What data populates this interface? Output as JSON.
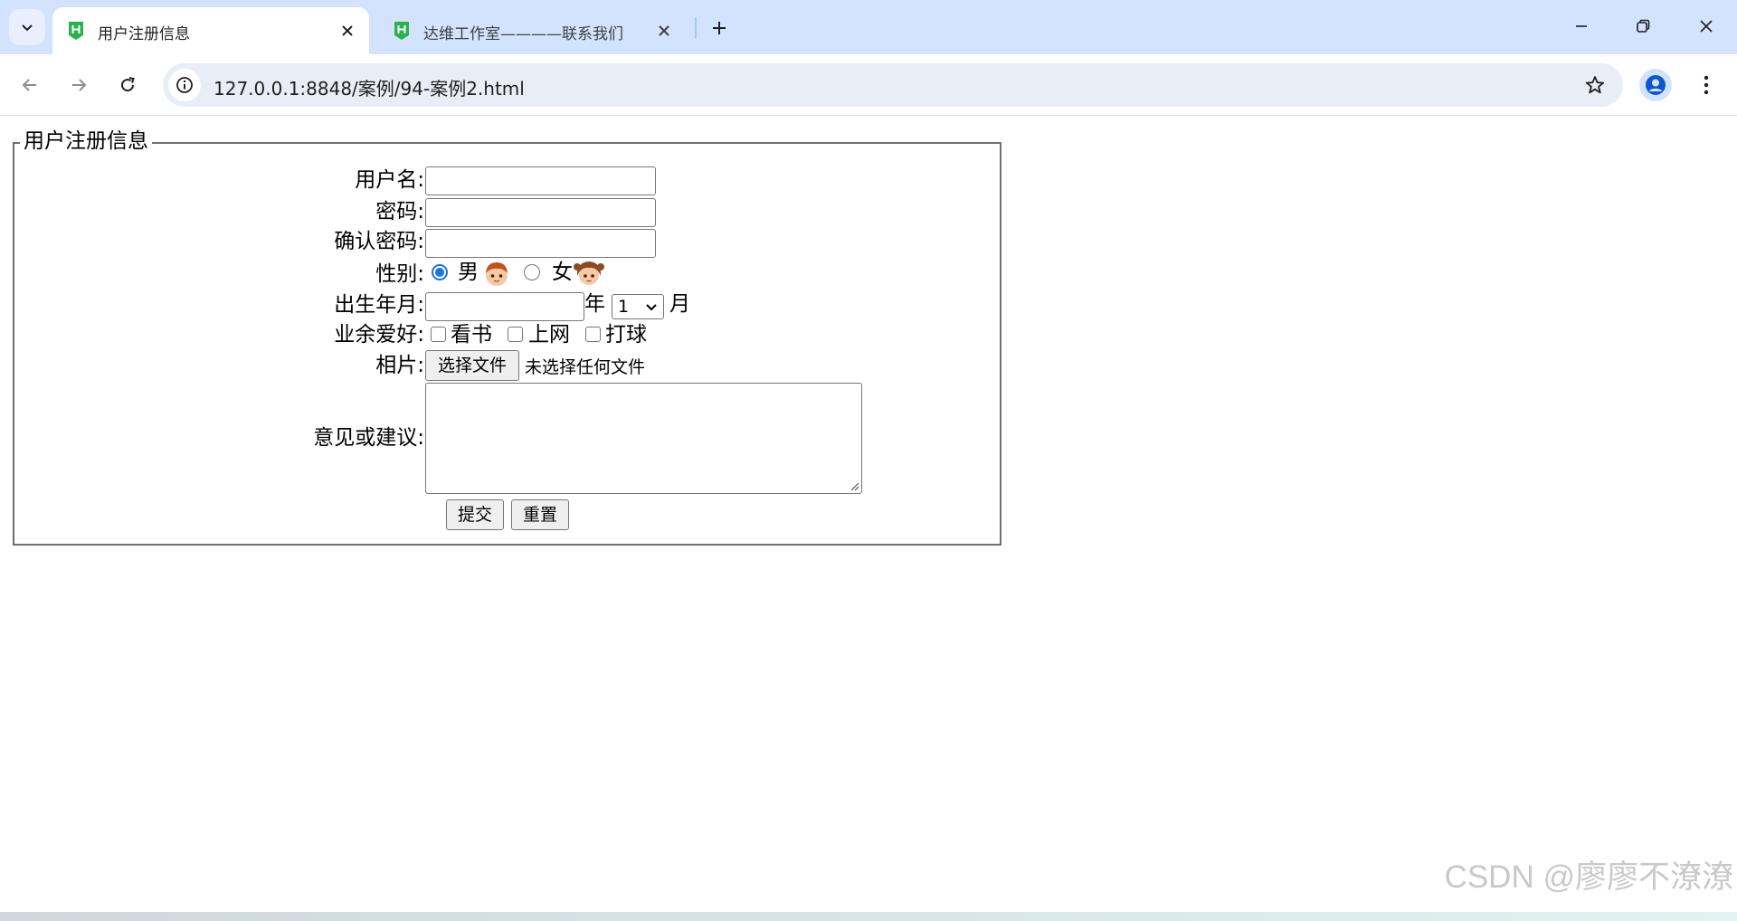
{
  "browser": {
    "tabs": [
      {
        "title": "用户注册信息",
        "active": true
      },
      {
        "title": "达维工作室————联系我们",
        "active": false
      }
    ],
    "url": "127.0.0.1:8848/案例/94-案例2.html",
    "accent_color": "#d3e3fd"
  },
  "form": {
    "legend": "用户注册信息",
    "username_label": "用户名:",
    "username_value": "",
    "password_label": "密码:",
    "password_value": "",
    "confirm_label": "确认密码:",
    "confirm_value": "",
    "gender_label": "性别:",
    "gender_options": [
      "男",
      "女"
    ],
    "gender_selected": "男",
    "birth_label": "出生年月:",
    "birth_year_value": "",
    "year_unit": "年",
    "month_selected": "1",
    "month_unit": "月",
    "hobby_label": "业余爱好:",
    "hobbies": [
      "看书",
      "上网",
      "打球"
    ],
    "photo_label": "相片:",
    "file_button": "选择文件",
    "file_status": "未选择任何文件",
    "suggest_label": "意见或建议:",
    "suggest_value": "",
    "submit_label": "提交",
    "reset_label": "重置"
  },
  "watermark": "CSDN @廖廖不潦潦"
}
